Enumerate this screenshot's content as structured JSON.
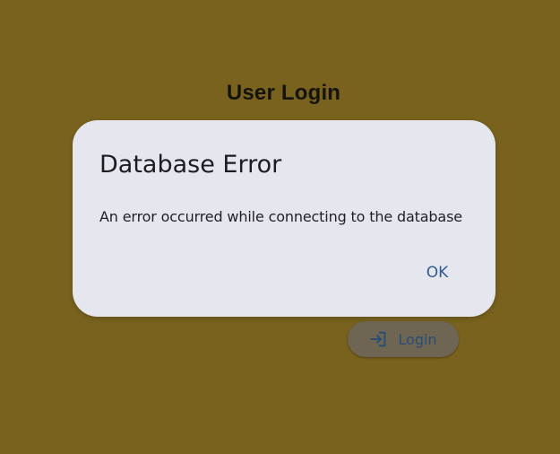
{
  "page": {
    "title": "User Login",
    "background_color": "#78621e"
  },
  "login_button": {
    "label": "Login",
    "icon": "login-icon",
    "color": "#2a4d78"
  },
  "dialog": {
    "title": "Database Error",
    "message": "An error occurred while connecting to the database",
    "ok_label": "OK",
    "accent_color": "#305b8d"
  }
}
